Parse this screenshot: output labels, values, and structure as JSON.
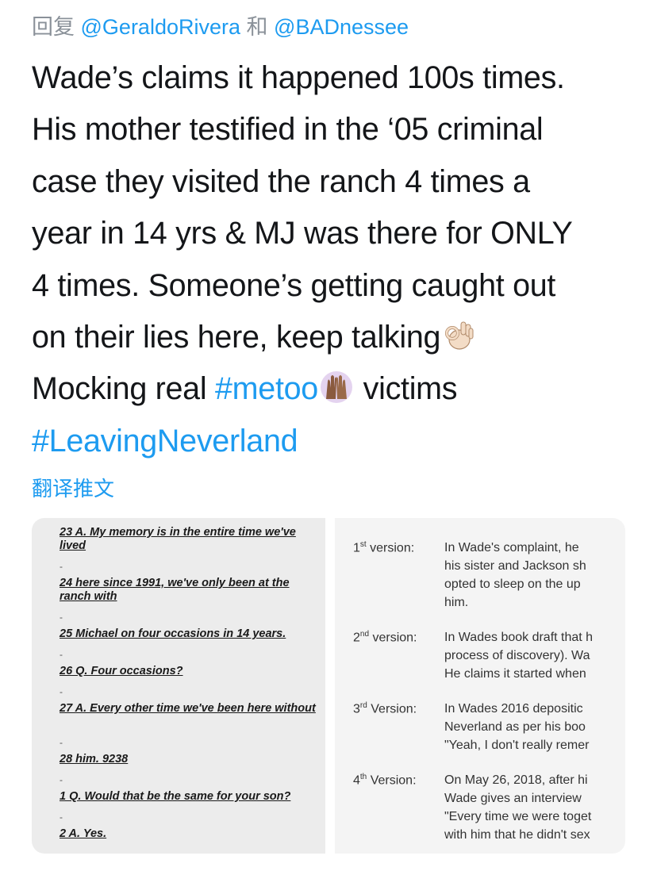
{
  "reply": {
    "prefix": "回复",
    "mention1": "@GeraldoRivera",
    "and": "和",
    "mention2": "@BADnessee"
  },
  "tweet": {
    "line1": "Wade’s claims it happened 100s times.",
    "line2": "His mother testified in the ‘05 criminal",
    "line3": "case they visited the ranch 4 times a",
    "line4": "year in 14 yrs & MJ was there for ONLY",
    "line5": "4 times. Someone’s getting caught out",
    "line6": "on their lies here, keep talking",
    "line7a": "Mocking real",
    "hashtag1": "#metoo",
    "line7b": "victims",
    "hashtag2": "#LeavingNeverland",
    "emoji1": "ok-hand-emoji",
    "emoji2": "raised-hands-emoji"
  },
  "translate_label": "翻译推文",
  "media": {
    "deposition": [
      {
        "text": "23 A. My memory is in the entire time we've lived"
      },
      {
        "text": "24 here since 1991, we've only been at the ranch with"
      },
      {
        "text": "25 Michael on four occasions in 14 years."
      },
      {
        "text": "26 Q. Four occasions?"
      },
      {
        "text": "27 A. Every other time we've been here without"
      },
      {
        "text": "28 him. 9238"
      },
      {
        "text": "1 Q. Would that be the same for your son?"
      },
      {
        "text": "2 A. Yes."
      }
    ],
    "versions": [
      {
        "num": "1",
        "sup": "st",
        "word": " version:",
        "lines": [
          "In Wade's complaint, he",
          "his sister and Jackson sh",
          "opted to sleep on the up",
          "him."
        ]
      },
      {
        "num": "2",
        "sup": "nd",
        "word": " version:",
        "lines": [
          "In Wades book draft that h",
          "process of discovery). Wa",
          "He claims it started when"
        ]
      },
      {
        "num": "3",
        "sup": "rd",
        "word": " Version:",
        "lines": [
          "In Wades 2016 depositic",
          "Neverland as per his boo",
          "\"Yeah, I don't really remer"
        ]
      },
      {
        "num": "4",
        "sup": "th",
        "word": " Version:",
        "lines": [
          "On May 26, 2018, after hi",
          "Wade gives an interview",
          "\"Every time we were toget",
          "with him that he didn't sex"
        ]
      }
    ]
  },
  "colors": {
    "link": "#1d9bf0",
    "text": "#141619",
    "muted": "#8a9199"
  }
}
